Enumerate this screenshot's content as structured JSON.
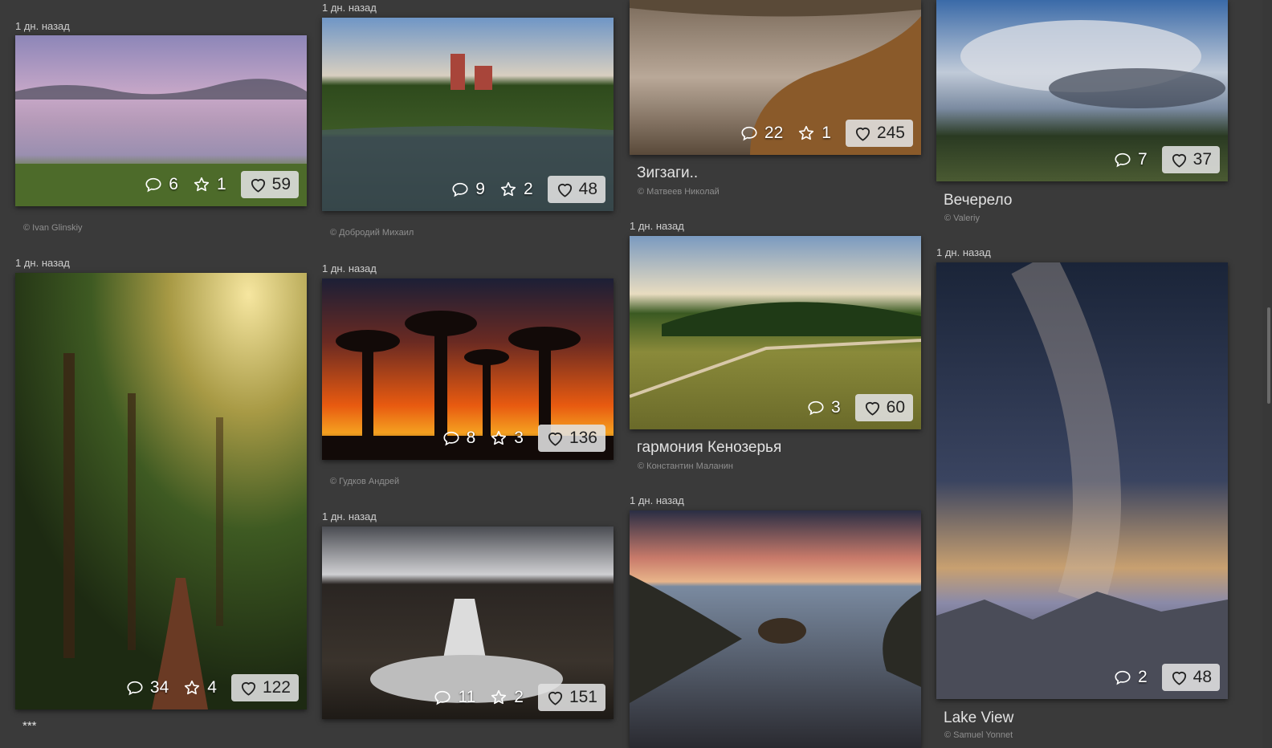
{
  "feed": {
    "col1": [
      {
        "time": "1 дн. назад",
        "author": "© Ivan Glinskiy",
        "comments": "6",
        "favorites": "1",
        "likes": "59"
      },
      {
        "time": "1 дн. назад",
        "title": "***",
        "comments": "34",
        "favorites": "4",
        "likes": "122"
      }
    ],
    "col2": [
      {
        "time": "1 дн. назад",
        "author": "© Добродий Михаил",
        "comments": "9",
        "favorites": "2",
        "likes": "48"
      },
      {
        "time": "1 дн. назад",
        "author": "© Гудков Андрей",
        "comments": "8",
        "favorites": "3",
        "likes": "136"
      },
      {
        "time": "1 дн. назад",
        "comments": "11",
        "favorites": "2",
        "likes": "151"
      }
    ],
    "col3": [
      {
        "title": "Зигзаги..",
        "author": "© Матвеев Николай",
        "comments": "22",
        "favorites": "1",
        "likes": "245"
      },
      {
        "time": "1 дн. назад",
        "title": "гармония Кенозерья",
        "author": "© Константин Маланин",
        "comments": "3",
        "likes": "60"
      },
      {
        "time": "1 дн. назад"
      }
    ],
    "col4": [
      {
        "title": "Вечерело",
        "author": "© Valeriy",
        "comments": "7",
        "likes": "37"
      },
      {
        "time": "1 дн. назад",
        "title": "Lake View",
        "author": "© Samuel Yonnet",
        "comments": "2",
        "likes": "48"
      }
    ]
  },
  "icons": {
    "comment": "comment-icon",
    "favorite": "star-icon",
    "like": "heart-icon"
  }
}
